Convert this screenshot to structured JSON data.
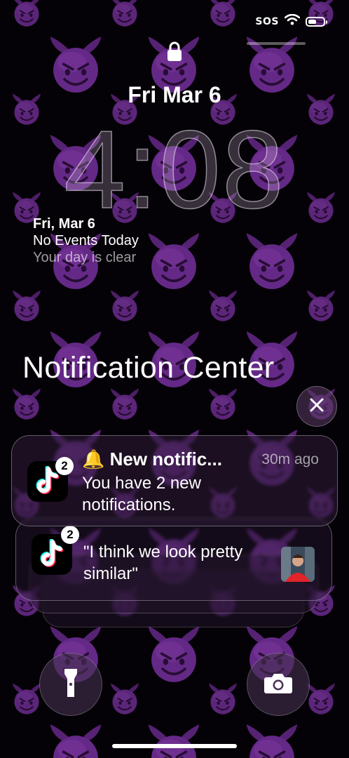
{
  "status_bar": {
    "carrier": "SOS"
  },
  "lock_screen": {
    "date": "Fri Mar 6",
    "time": "4:08",
    "widget": {
      "date": "Fri, Mar 6",
      "events": "No Events Today",
      "subtitle": "Your day is clear"
    }
  },
  "notification_center": {
    "title": "Notification Center",
    "notifications": [
      {
        "app": "TikTok",
        "badge": "2",
        "title": "🔔 New notific...",
        "time": "30m ago",
        "body": "You have 2 new notifications."
      },
      {
        "app": "TikTok",
        "badge": "2",
        "body": "\"I think we look pretty similar\""
      }
    ]
  },
  "icons": [
    "lock-icon",
    "wifi-icon",
    "battery-icon",
    "close-icon",
    "tiktok-icon",
    "flashlight-icon",
    "camera-icon"
  ],
  "colors": {
    "wallpaper_emoji": "#6a2c8e",
    "accent_red": "#ff2b54",
    "accent_cyan": "#25f4ee"
  }
}
